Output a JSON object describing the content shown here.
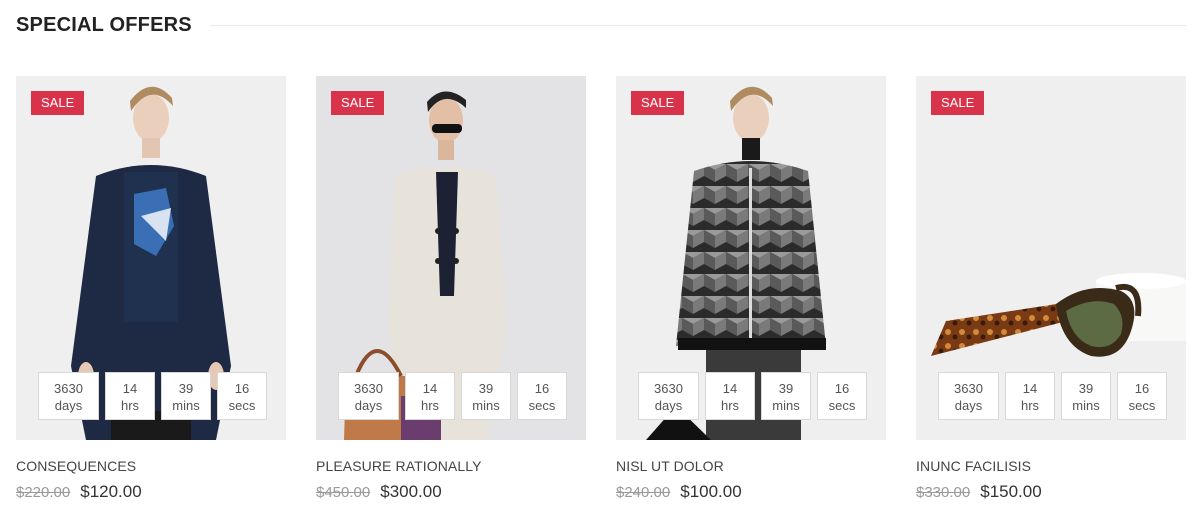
{
  "section": {
    "title": "SPECIAL OFFERS"
  },
  "products": [
    {
      "title": "CONSEQUENCES",
      "badge": "SALE",
      "old_price": "$220.00",
      "new_price": "$120.00",
      "countdown": {
        "days": "3630",
        "days_label": "days",
        "hrs": "14",
        "hrs_label": "hrs",
        "mins": "39",
        "mins_label": "mins",
        "secs": "16",
        "secs_label": "secs"
      }
    },
    {
      "title": "PLEASURE RATIONALLY",
      "badge": "SALE",
      "old_price": "$450.00",
      "new_price": "$300.00",
      "countdown": {
        "days": "3630",
        "days_label": "days",
        "hrs": "14",
        "hrs_label": "hrs",
        "mins": "39",
        "mins_label": "mins",
        "secs": "16",
        "secs_label": "secs"
      }
    },
    {
      "title": "NISL UT DOLOR",
      "badge": "SALE",
      "old_price": "$240.00",
      "new_price": "$100.00",
      "countdown": {
        "days": "3630",
        "days_label": "days",
        "hrs": "14",
        "hrs_label": "hrs",
        "mins": "39",
        "mins_label": "mins",
        "secs": "16",
        "secs_label": "secs"
      }
    },
    {
      "title": "INUNC FACILISIS",
      "badge": "SALE",
      "old_price": "$330.00",
      "new_price": "$150.00",
      "countdown": {
        "days": "3630",
        "days_label": "days",
        "hrs": "14",
        "hrs_label": "hrs",
        "mins": "39",
        "mins_label": "mins",
        "secs": "16",
        "secs_label": "secs"
      }
    }
  ],
  "colors": {
    "badge": "#d9334b",
    "thumb_bg": "#efefef"
  }
}
